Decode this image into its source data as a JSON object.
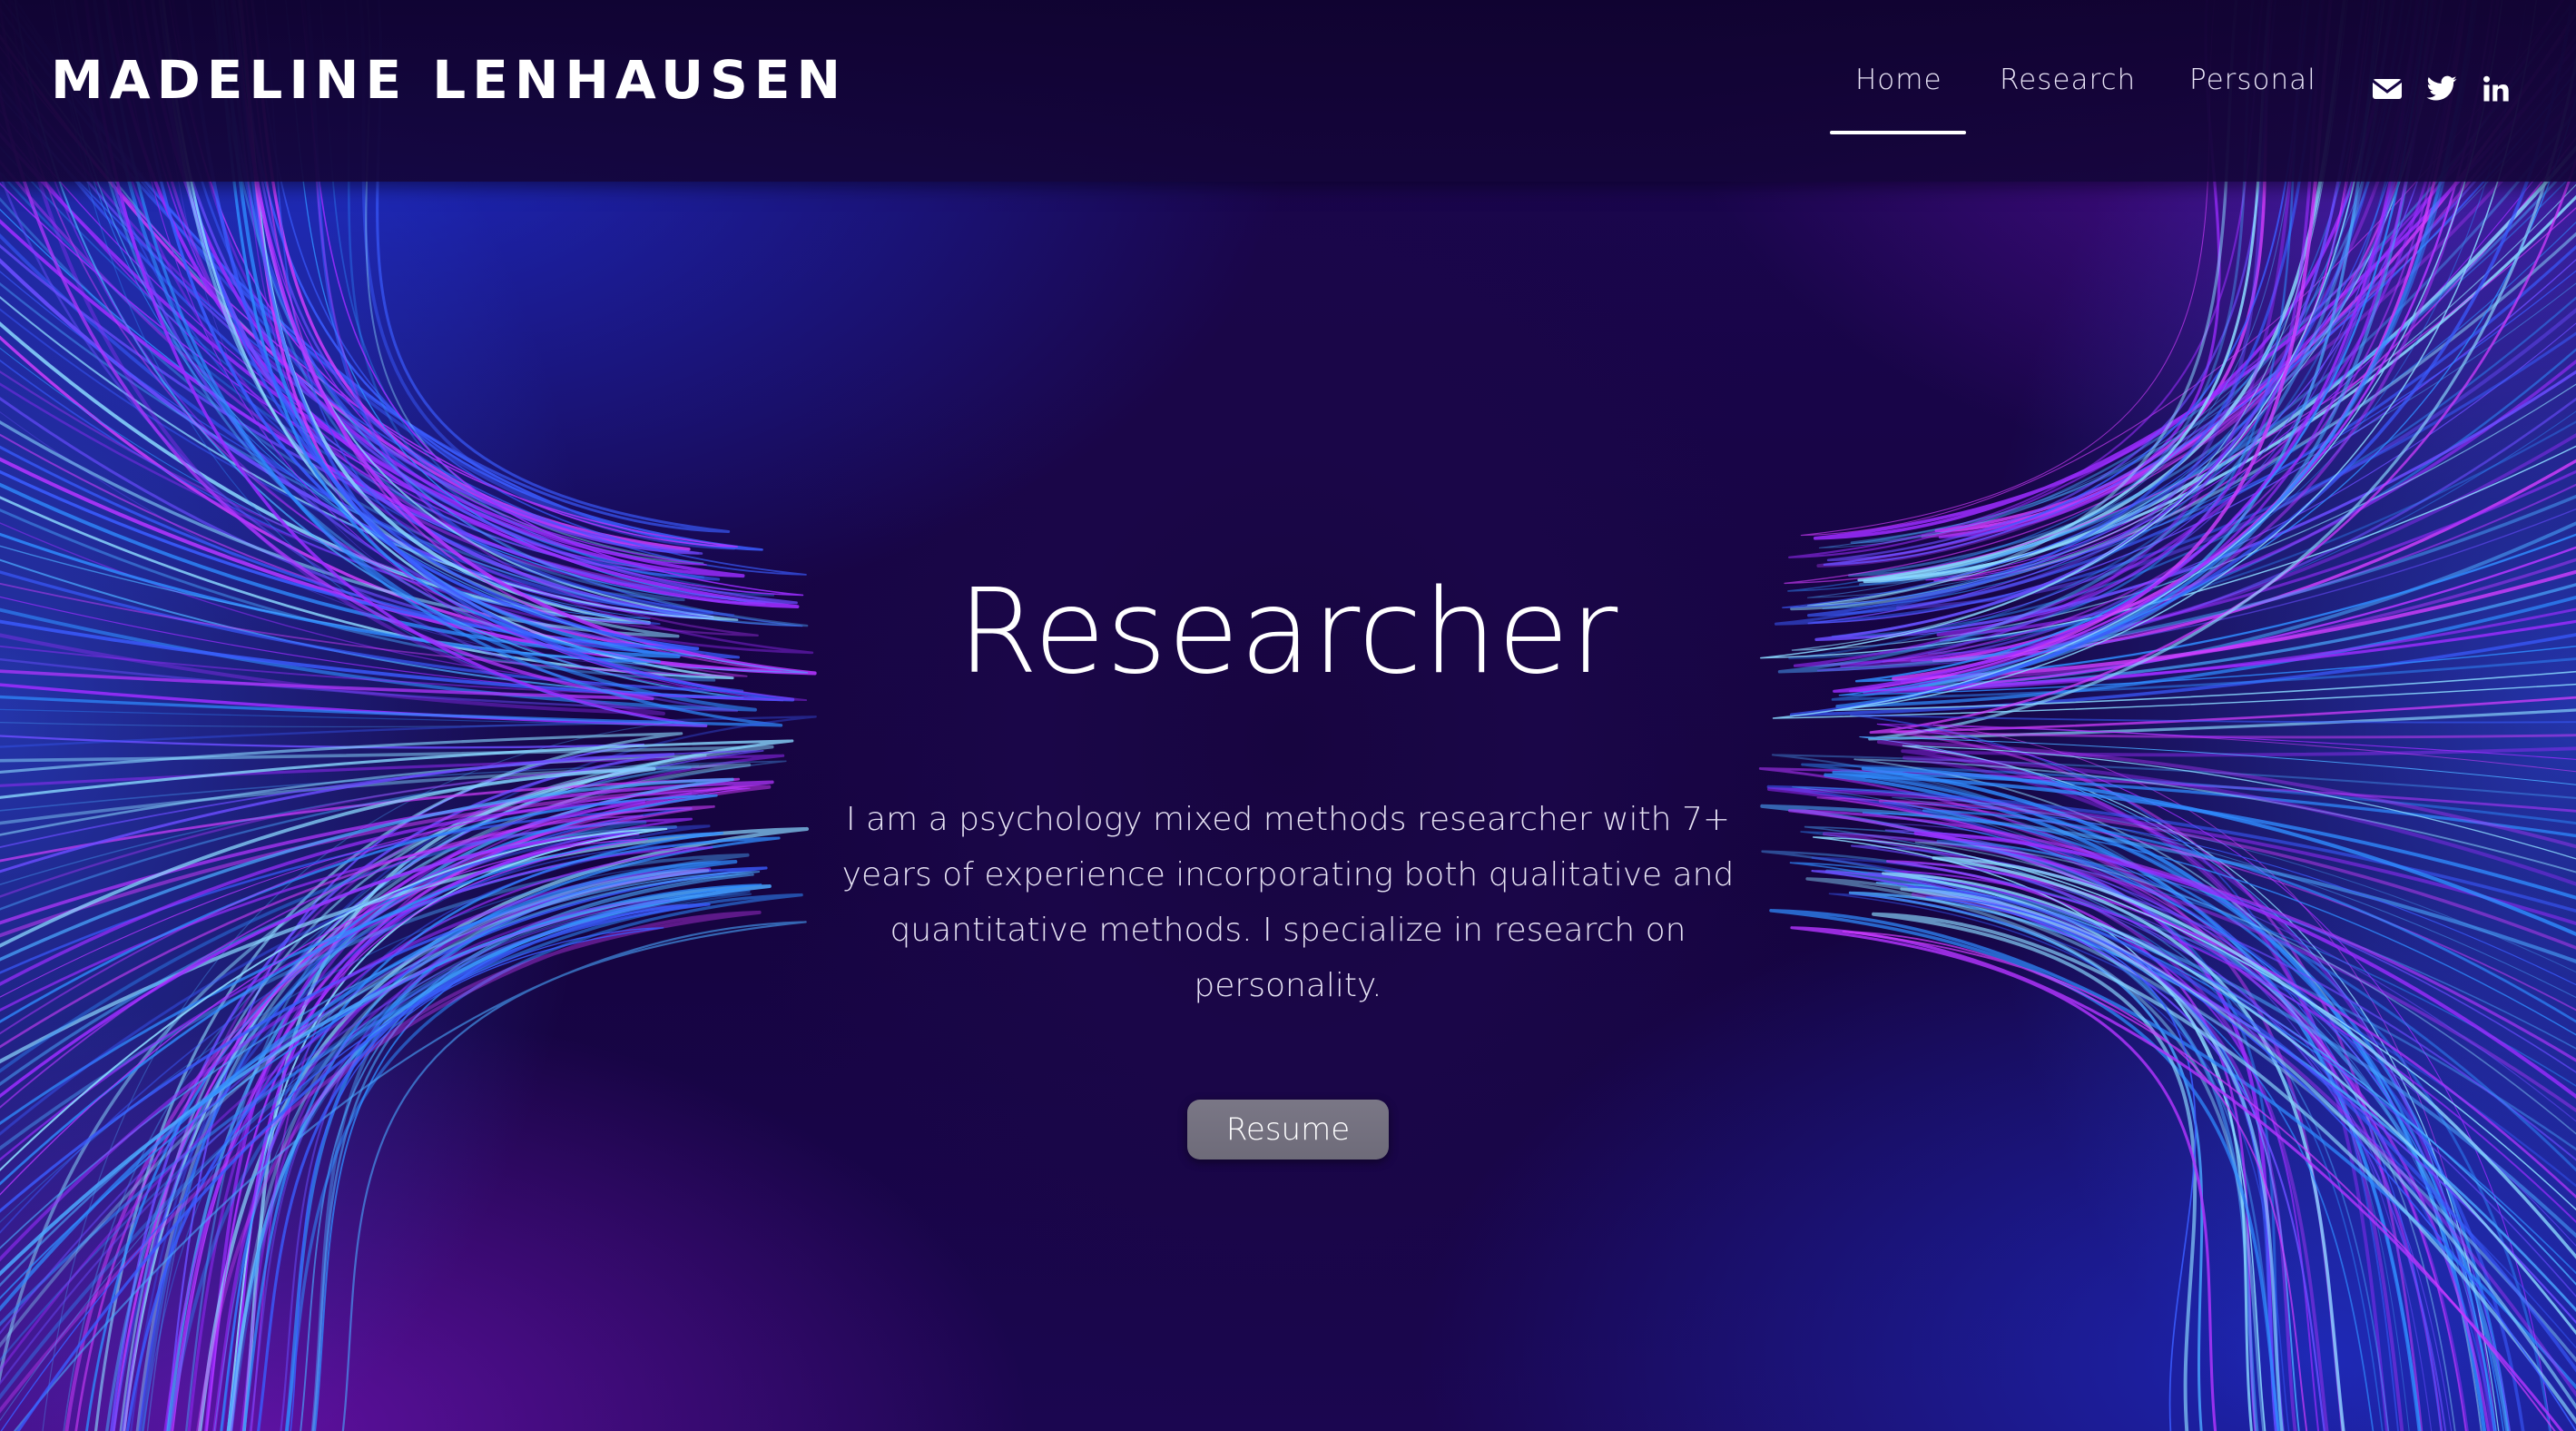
{
  "header": {
    "brand": "MADELINE LENHAUSEN",
    "nav": [
      {
        "label": "Home",
        "active": true
      },
      {
        "label": "Research",
        "active": false
      },
      {
        "label": "Personal",
        "active": false
      }
    ],
    "social_icons": [
      "mail-icon",
      "twitter-icon",
      "linkedin-icon"
    ]
  },
  "hero": {
    "title": "Researcher",
    "description": "I am a psychology mixed methods researcher with 7+ years of experience incorporating both qualitative and quantitative methods. I specialize in research on personality.",
    "button_label": "Resume"
  },
  "colors": {
    "background": "#1a0648",
    "accent_blue": "#2a8cff",
    "accent_magenta": "#c42cff",
    "text": "#ffffff",
    "button": "#757280"
  }
}
